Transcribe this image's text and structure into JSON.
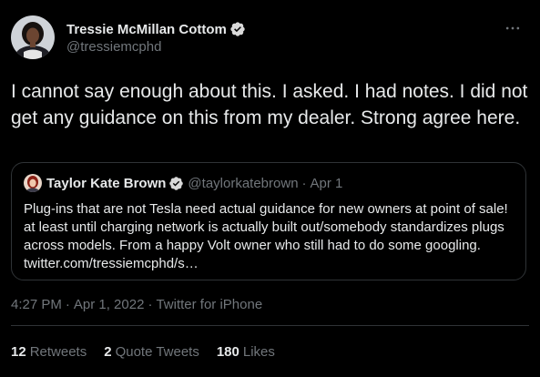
{
  "tweet": {
    "author": {
      "display_name": "Tressie McMillan Cottom",
      "handle": "@tressiemcphd",
      "verified": true
    },
    "text": "I cannot say enough about this. I asked. I had notes. I did not get any guidance on this from my dealer. Strong agree here.",
    "quoted": {
      "display_name": "Taylor Kate Brown",
      "handle": "@taylorkatebrown",
      "separator": "·",
      "date": "Apr 1",
      "verified": true,
      "text": "Plug-ins that are not Tesla need actual guidance for new owners at point of sale! at least until charging network is actually built out/somebody standardizes plugs across models. From a happy Volt owner who still had to do some googling.",
      "link": "twitter.com/tressiemcphd/s…"
    },
    "meta": {
      "time": "4:27 PM",
      "separator": "·",
      "date": "Apr 1, 2022",
      "separator2": "·",
      "source": "Twitter for iPhone"
    },
    "stats": {
      "retweets_count": "12",
      "retweets_label": "Retweets",
      "quotes_count": "2",
      "quotes_label": "Quote Tweets",
      "likes_count": "180",
      "likes_label": "Likes"
    }
  },
  "icons": {
    "verified": "verified-badge-icon",
    "more": "more-options-icon"
  },
  "colors": {
    "background": "#000000",
    "text_primary": "#e7e9ea",
    "text_secondary": "#71767b",
    "border": "#2f3336",
    "verified_badge": "#d9d9d9"
  }
}
